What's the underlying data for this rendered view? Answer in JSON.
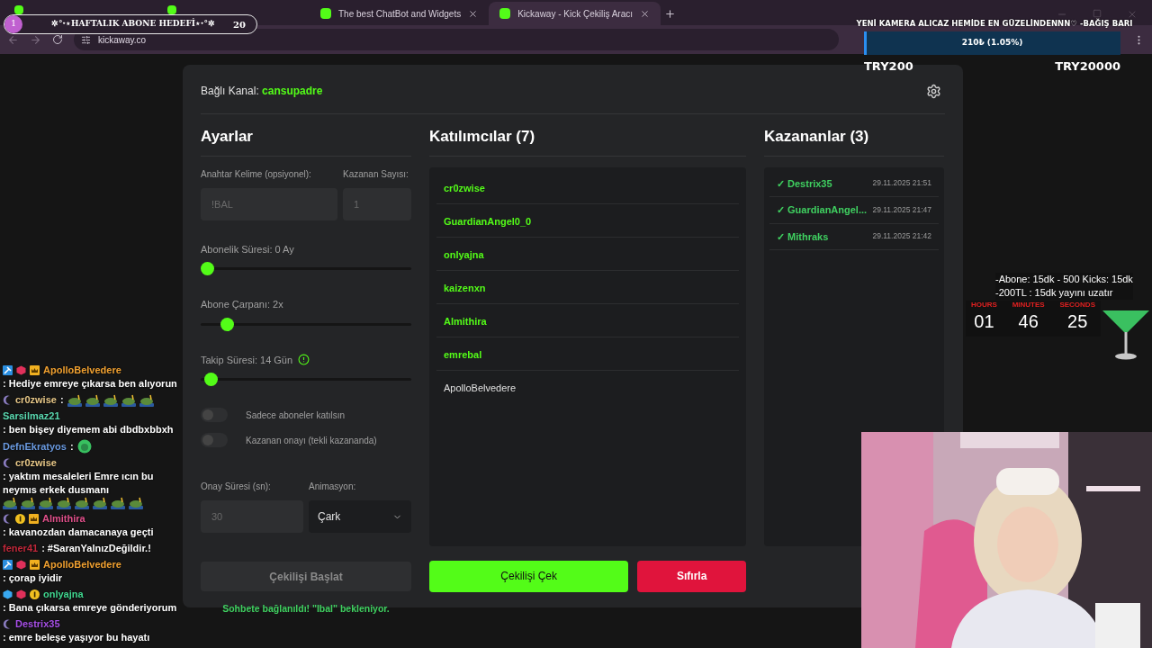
{
  "browser": {
    "tabs": [
      {
        "selected": false
      },
      {
        "selected": false
      },
      {
        "label": "The best ChatBot and Widgets",
        "selected": false
      },
      {
        "label": "Kickaway - Kick Çekiliş Aracı",
        "selected": true
      }
    ],
    "url": "kickaway.co"
  },
  "subgoal": {
    "badge": "1",
    "title": "✲°˖⋆HAFTALIK ABONE HEDEFİ⋆˖°✲",
    "count": "20"
  },
  "donation": {
    "title": "YENİ KAMERA ALICAZ HEMİDE EN GÜZELİNDENNN♡ -BAĞIŞ BARI",
    "reading": "210₺ (1.05%)",
    "level": 0.0105,
    "min": "TRY200",
    "max": "TRY20000"
  },
  "app": {
    "channel_label": "Bağlı Kanal:",
    "channel": "cansupadre",
    "settings": {
      "title": "Ayarlar",
      "keyword_label": "Anahtar Kelime (opsiyonel):",
      "keyword": {
        "placeholder": "!BAL"
      },
      "count_label": "Kazanan Sayısı:",
      "count": {
        "placeholder": "1"
      },
      "sliders": [
        {
          "label": "Abonelik Süresi: 0 Ay",
          "level": 0
        },
        {
          "label": "Abone Çarpanı: 2x",
          "level": 0.1
        },
        {
          "label": "Takip Süresi: 14 Gün",
          "level": 0.02,
          "info": true
        }
      ],
      "toggles": [
        {
          "label": "Sadece aboneler katılsın",
          "on": false
        },
        {
          "label": "Kazanan onayı (tekli kazananda)",
          "on": false
        }
      ],
      "confirm_label": "Onay Süresi (sn):",
      "confirm": {
        "placeholder": "30"
      },
      "animation_label": "Animasyon:",
      "animation": "Çark",
      "start_button": {
        "label": "Çekilişi Başlat",
        "disabled": true
      },
      "status": "Sohbete bağlanıldı! \"Ibal\" bekleniyor."
    },
    "participants": {
      "title": "Katılımcılar (7)",
      "items": [
        {
          "name": "cr0zwise",
          "active": true
        },
        {
          "name": "GuardianAngel0_0",
          "active": true
        },
        {
          "name": "onlyajna",
          "active": true
        },
        {
          "name": "kaizenxn",
          "active": true
        },
        {
          "name": "Almithira",
          "active": true
        },
        {
          "name": "emrebal",
          "active": true
        },
        {
          "name": "ApolloBelvedere",
          "active": false
        }
      ],
      "draw_button": "Çekilişi Çek",
      "reset_button": "Sıfırla"
    },
    "winners": {
      "title": "Kazananlar (3)",
      "items": [
        {
          "mark": "✓",
          "name": "Destrix35",
          "time": "29.11.2025 21:51"
        },
        {
          "mark": "✓",
          "name": "GuardianAngel...",
          "time": "29.11.2025 21:47"
        },
        {
          "mark": "✓",
          "name": "Mithraks",
          "time": "29.11.2025 21:42"
        }
      ]
    }
  },
  "timer": {
    "notes": [
      "-Abone: 15dk - 500 Kicks: 15dk",
      "-200TL : 15dk yayını uzatır"
    ],
    "units": [
      {
        "label": "HOURS",
        "value": "01"
      },
      {
        "label": "MINUTES",
        "value": "46"
      },
      {
        "label": "SECONDS",
        "value": "25"
      }
    ]
  },
  "chat": [
    {
      "badges": [
        {
          "kind": "hammer"
        },
        {
          "kind": "gem"
        },
        {
          "kind": "crown"
        }
      ],
      "user": "ApolloBelvedere",
      "color": "#f0a030",
      "text": ": Hediye emreye çıkarsa ben alıyorun"
    },
    {
      "badges": [
        {
          "kind": "moon"
        }
      ],
      "user": "cr0zwise",
      "color": "#e8c888",
      "text": ":",
      "emotes": [
        {
          "kind": "frog"
        },
        {
          "kind": "frog"
        },
        {
          "kind": "frog"
        },
        {
          "kind": "frog"
        },
        {
          "kind": "frog"
        }
      ]
    },
    {
      "user": "Sarsilmaz21",
      "color": "#5ad8b0",
      "text": ": ben bişey diyemem abi dbdbxbbxh"
    },
    {
      "user": "DefnEkratyos",
      "color": "#6a9ae0",
      "text": ":",
      "emotes": [
        {
          "kind": "face"
        }
      ]
    },
    {
      "badges": [
        {
          "kind": "moon"
        }
      ],
      "user": "cr0zwise",
      "color": "#e8c888",
      "text": ": yaktım mesaleleri Emre ıcın bu neymıs erkek dusmanı",
      "emotes": [
        {
          "kind": "frog"
        },
        {
          "kind": "frog"
        },
        {
          "kind": "frog"
        },
        {
          "kind": "frog"
        },
        {
          "kind": "frog"
        },
        {
          "kind": "frog"
        },
        {
          "kind": "frog"
        },
        {
          "kind": "frog"
        }
      ]
    },
    {
      "badges": [
        {
          "kind": "moon"
        },
        {
          "kind": "one"
        },
        {
          "kind": "crown"
        }
      ],
      "user": "Almithira",
      "color": "#e0508a",
      "text": ": kavanozdan damacanaya geçti"
    },
    {
      "user": "fener41",
      "color": "#c0283a",
      "text": ": #SaranYalnızDeğildir.!"
    },
    {
      "badges": [
        {
          "kind": "hammer"
        },
        {
          "kind": "gem"
        },
        {
          "kind": "crown"
        }
      ],
      "user": "ApolloBelvedere",
      "color": "#f0a030",
      "text": ": çorap iyidir"
    },
    {
      "badges": [
        {
          "kind": "cube"
        },
        {
          "kind": "gem"
        },
        {
          "kind": "one"
        }
      ],
      "user": "onlyajna",
      "color": "#40d890",
      "text": ": Bana çıkarsa emreye gönderiyorum"
    },
    {
      "badges": [
        {
          "kind": "moon"
        }
      ],
      "user": "Destrix35",
      "color": "#a850e8",
      "text": ": emre beleşe yaşıyor bu hayatı"
    }
  ]
}
